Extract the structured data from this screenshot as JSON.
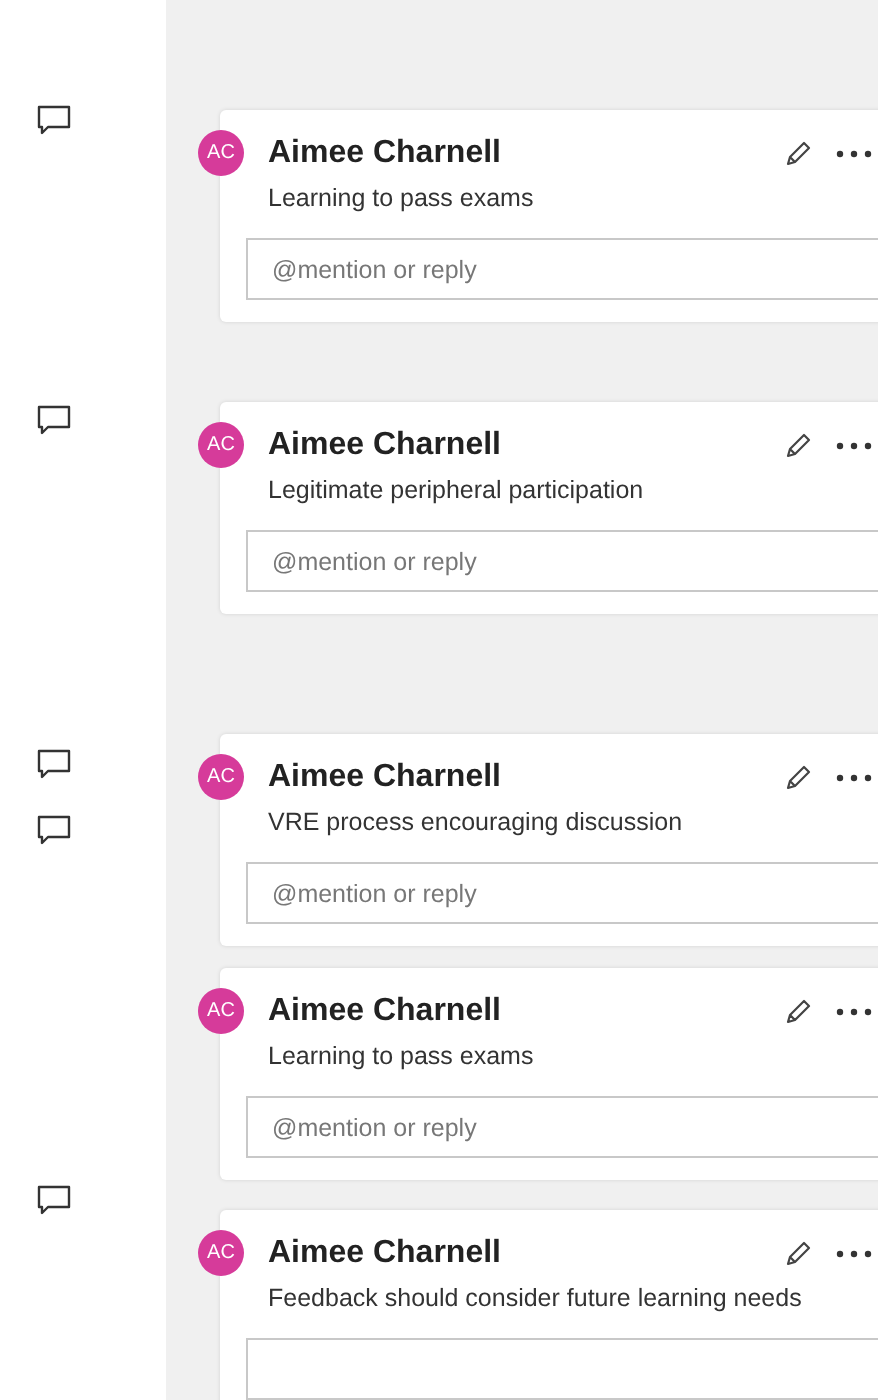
{
  "margin_markers": [
    {
      "kind": "comment"
    },
    {
      "kind": "comment"
    },
    {
      "kind": "comment"
    },
    {
      "kind": "comment"
    },
    {
      "kind": "comment"
    }
  ],
  "comments": [
    {
      "initials": "AC",
      "color": "#d63b9a",
      "author": "Aimee Charnell",
      "text": "Learning to pass exams",
      "reply": {
        "placeholder": "@mention or reply"
      }
    },
    {
      "initials": "AC",
      "color": "#d63b9a",
      "author": "Aimee Charnell",
      "text": "Legitimate peripheral participation",
      "reply": {
        "placeholder": "@mention or reply"
      }
    },
    {
      "initials": "AC",
      "color": "#d63b9a",
      "author": "Aimee Charnell",
      "text": "VRE process encouraging discussion",
      "reply": {
        "placeholder": "@mention or reply"
      }
    },
    {
      "initials": "AC",
      "color": "#d63b9a",
      "author": "Aimee Charnell",
      "text": "Learning to pass exams",
      "reply": {
        "placeholder": "@mention or reply"
      }
    },
    {
      "initials": "AC",
      "color": "#d63b9a",
      "author": "Aimee Charnell",
      "text": "Feedback should consider future learning needs",
      "reply": {
        "kind": "field"
      }
    }
  ]
}
